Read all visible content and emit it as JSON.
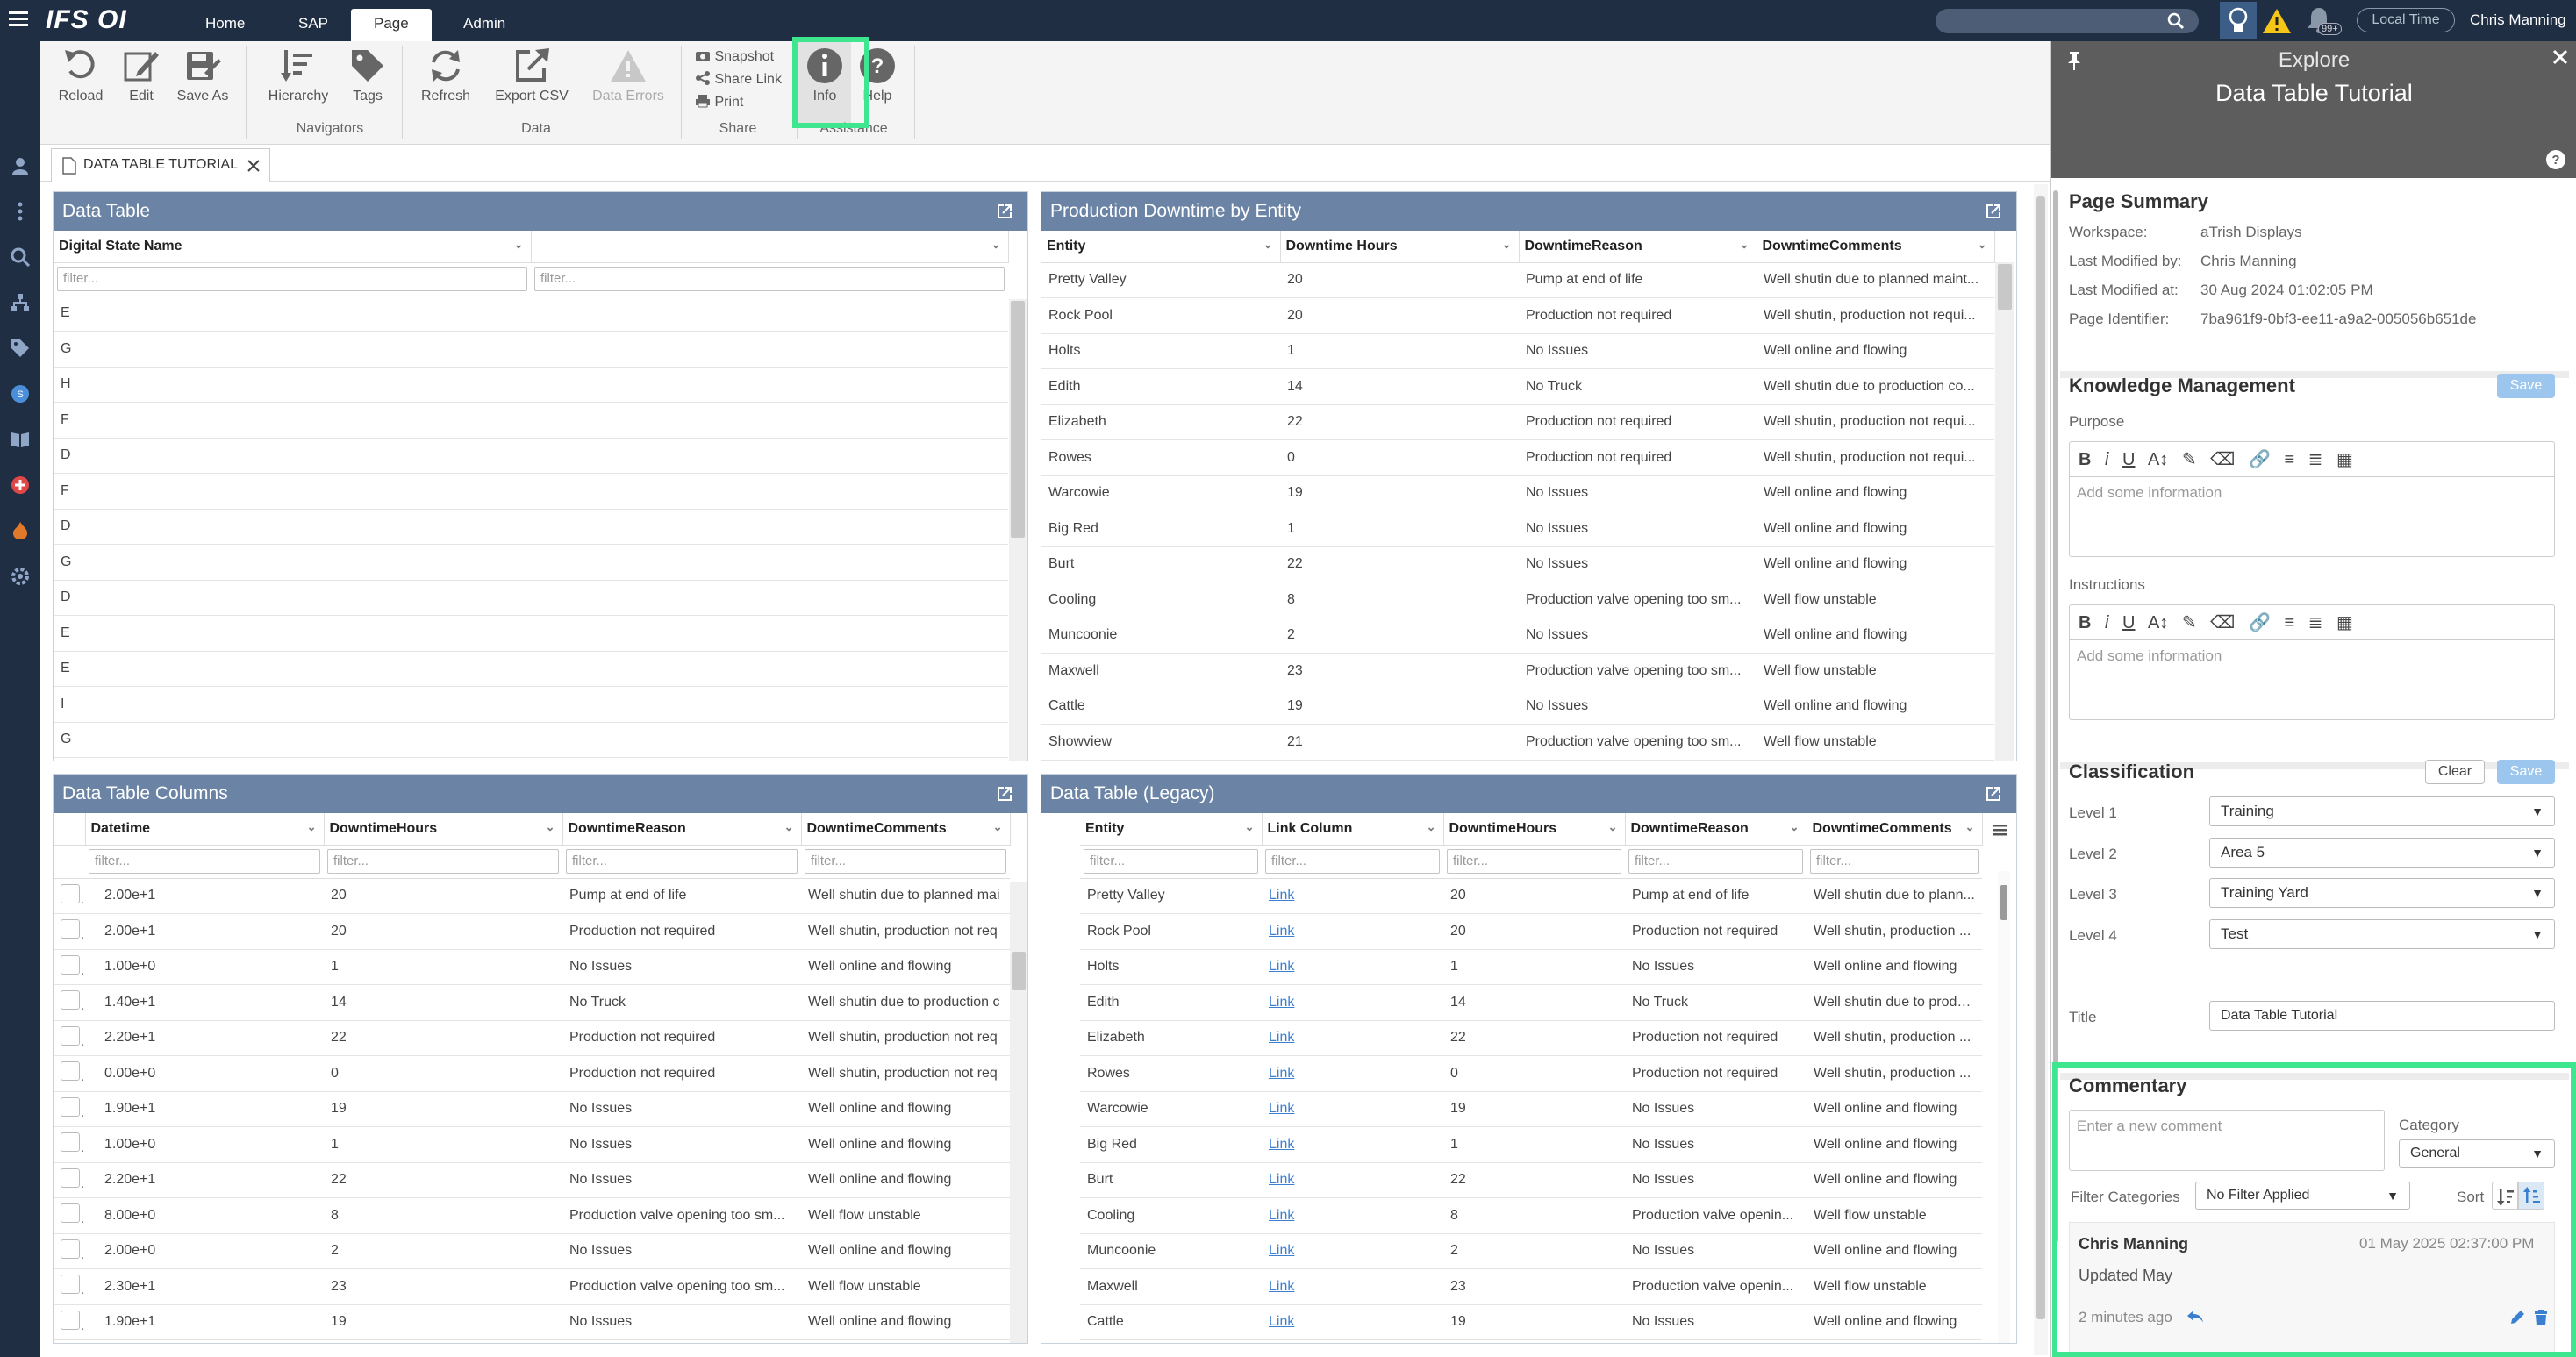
{
  "topbar": {
    "logo": "IFS OI",
    "nav": [
      "Home",
      "SAP",
      "Page",
      "Admin"
    ],
    "search_placeholder": "",
    "notif_badge": "99+",
    "local_time": "Local Time",
    "user": "Chris Manning"
  },
  "ribbon": {
    "buttons": {
      "reload": "Reload",
      "edit": "Edit",
      "saveas": "Save As",
      "hierarchy": "Hierarchy",
      "tags": "Tags",
      "refresh": "Refresh",
      "export": "Export CSV",
      "errors": "Data Errors",
      "info": "Info",
      "help": "Help"
    },
    "share": {
      "snapshot": "Snapshot",
      "link": "Share Link",
      "print": "Print"
    },
    "groups": {
      "navigators": "Navigators",
      "data": "Data",
      "share": "Share",
      "assistance": "Assistance"
    }
  },
  "doc_tab": "DATA TABLE TUTORIAL",
  "panel1": {
    "title": "Data Table",
    "col1": "Digital State Name",
    "col2": "",
    "filter_ph": "filter...",
    "rows": [
      "E",
      "G",
      "H",
      "F",
      "D",
      "F",
      "D",
      "G",
      "D",
      "E",
      "E",
      "I",
      "G"
    ]
  },
  "panel2": {
    "title": "Production Downtime by Entity",
    "headers": [
      "Entity",
      "Downtime Hours",
      "DowntimeReason",
      "DowntimeComments"
    ],
    "rows": [
      [
        "Pretty Valley",
        "20",
        "Pump at end of life",
        "Well shutin due to planned maint..."
      ],
      [
        "Rock Pool",
        "20",
        "Production not required",
        "Well shutin, production not requi..."
      ],
      [
        "Holts",
        "1",
        "No Issues",
        "Well online and flowing"
      ],
      [
        "Edith",
        "14",
        "No Truck",
        "Well shutin due to production co..."
      ],
      [
        "Elizabeth",
        "22",
        "Production not required",
        "Well shutin, production not requi..."
      ],
      [
        "Rowes",
        "0",
        "Production not required",
        "Well shutin, production not requi..."
      ],
      [
        "Warcowie",
        "19",
        "No Issues",
        "Well online and flowing"
      ],
      [
        "Big Red",
        "1",
        "No Issues",
        "Well online and flowing"
      ],
      [
        "Burt",
        "22",
        "No Issues",
        "Well online and flowing"
      ],
      [
        "Cooling",
        "8",
        "Production valve opening too sm...",
        "Well flow unstable"
      ],
      [
        "Muncoonie",
        "2",
        "No Issues",
        "Well online and flowing"
      ],
      [
        "Maxwell",
        "23",
        "Production valve opening too sm...",
        "Well flow unstable"
      ],
      [
        "Cattle",
        "19",
        "No Issues",
        "Well online and flowing"
      ],
      [
        "Showview",
        "21",
        "Production valve opening too sm...",
        "Well flow unstable"
      ]
    ]
  },
  "panel3": {
    "title": "Data Table Columns",
    "headers": [
      "Datetime",
      "DowntimeHours",
      "DowntimeReason",
      "DowntimeComments"
    ],
    "filter_ph": "filter...",
    "rows": [
      [
        "2.00e+1",
        "20",
        "Pump at end of life",
        "Well shutin due to planned mai"
      ],
      [
        "2.00e+1",
        "20",
        "Production not required",
        "Well shutin, production not req"
      ],
      [
        "1.00e+0",
        "1",
        "No Issues",
        "Well online and flowing"
      ],
      [
        "1.40e+1",
        "14",
        "No Truck",
        "Well shutin due to production c"
      ],
      [
        "2.20e+1",
        "22",
        "Production not required",
        "Well shutin, production not req"
      ],
      [
        "0.00e+0",
        "0",
        "Production not required",
        "Well shutin, production not req"
      ],
      [
        "1.90e+1",
        "19",
        "No Issues",
        "Well online and flowing"
      ],
      [
        "1.00e+0",
        "1",
        "No Issues",
        "Well online and flowing"
      ],
      [
        "2.20e+1",
        "22",
        "No Issues",
        "Well online and flowing"
      ],
      [
        "8.00e+0",
        "8",
        "Production valve opening too sm...",
        "Well flow unstable"
      ],
      [
        "2.00e+0",
        "2",
        "No Issues",
        "Well online and flowing"
      ],
      [
        "2.30e+1",
        "23",
        "Production valve opening too sm...",
        "Well flow unstable"
      ],
      [
        "1.90e+1",
        "19",
        "No Issues",
        "Well online and flowing"
      ]
    ]
  },
  "panel4": {
    "title": "Data Table (Legacy)",
    "headers": [
      "Entity",
      "Link Column",
      "DowntimeHours",
      "DowntimeReason",
      "DowntimeComments"
    ],
    "filter_ph": "filter...",
    "link_text": "Link",
    "rows": [
      [
        "Pretty Valley",
        "20",
        "Pump at end of life",
        "Well shutin due to plann..."
      ],
      [
        "Rock Pool",
        "20",
        "Production not required",
        "Well shutin, production ..."
      ],
      [
        "Holts",
        "1",
        "No Issues",
        "Well online and flowing"
      ],
      [
        "Edith",
        "14",
        "No Truck",
        "Well shutin due to produ..."
      ],
      [
        "Elizabeth",
        "22",
        "Production not required",
        "Well shutin, production ..."
      ],
      [
        "Rowes",
        "0",
        "Production not required",
        "Well shutin, production ..."
      ],
      [
        "Warcowie",
        "19",
        "No Issues",
        "Well online and flowing"
      ],
      [
        "Big Red",
        "1",
        "No Issues",
        "Well online and flowing"
      ],
      [
        "Burt",
        "22",
        "No Issues",
        "Well online and flowing"
      ],
      [
        "Cooling",
        "8",
        "Production valve openin...",
        "Well flow unstable"
      ],
      [
        "Muncoonie",
        "2",
        "No Issues",
        "Well online and flowing"
      ],
      [
        "Maxwell",
        "23",
        "Production valve openin...",
        "Well flow unstable"
      ],
      [
        "Cattle",
        "19",
        "No Issues",
        "Well online and flowing"
      ]
    ]
  },
  "explore": {
    "heading": "Explore",
    "subtitle": "Data Table Tutorial",
    "summary": {
      "title": "Page Summary",
      "labels": [
        "Workspace:",
        "Last Modified by:",
        "Last Modified at:",
        "Page Identifier:"
      ],
      "values": [
        "aTrish Displays",
        "Chris Manning",
        "30 Aug 2024 01:02:05 PM",
        "7ba961f9-0bf3-ee11-a9a2-005056b651de"
      ]
    },
    "km": {
      "title": "Knowledge Management",
      "save": "Save",
      "purpose": "Purpose",
      "instructions": "Instructions",
      "placeholder": "Add some information"
    },
    "classification": {
      "title": "Classification",
      "clear": "Clear",
      "save": "Save",
      "labels": [
        "Level 1",
        "Level 2",
        "Level 3",
        "Level 4",
        "Title"
      ],
      "values": [
        "Training",
        "Area 5",
        "Training Yard",
        "Test",
        "Data Table Tutorial"
      ]
    },
    "commentary": {
      "title": "Commentary",
      "placeholder": "Enter a new comment",
      "category_label": "Category",
      "category": "General",
      "filter_label": "Filter Categories",
      "filter_value": "No Filter Applied",
      "sort_label": "Sort",
      "comment": {
        "author": "Chris Manning",
        "date": "01 May 2025 02:37:00 PM",
        "text": "Updated May",
        "ago": "2 minutes ago"
      }
    }
  }
}
